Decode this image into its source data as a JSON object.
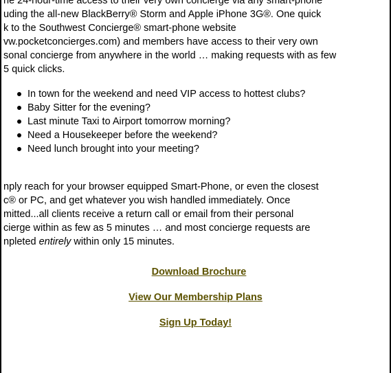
{
  "paragraph_top": [
    "ne 24-hour-time access to their very own concierge via any smart-phone",
    "uding the all-new BlackBerry® Storm and Apple iPhone 3G®. One quick",
    "k to the Southwest Concierge® smart-phone website",
    "vw.pocketconcierges.com) and members have access to their very own",
    "sonal concierge from anywhere in the world … making requests with as few",
    "5 quick clicks."
  ],
  "bullets": [
    "In town for the weekend and need VIP access to hottest clubs?",
    "Baby Sitter for the evening?",
    "Last minute Taxi to Airport tomorrow morning?",
    "Need a Housekeeper before the weekend?",
    "Need lunch brought into your meeting?"
  ],
  "paragraph_bottom": {
    "line1": "nply reach for your browser equipped Smart-Phone, or even the closest",
    "line2": "c® or PC, and get whatever you wish handled immediately. Once",
    "line3": "mitted...all clients receive a return call or email from their personal",
    "line4": "cierge within as few as 5 minutes … and most concierge requests are",
    "line5_before": "npleted ",
    "line5_emphasis": "entirely",
    "line5_after": " within only 15 minutes."
  },
  "links": {
    "download": "Download Brochure",
    "plans": "View Our Membership Plans",
    "signup": "Sign Up Today!"
  },
  "colors": {
    "link": "#5c5200",
    "text": "#000000",
    "background": "#ffffff"
  }
}
